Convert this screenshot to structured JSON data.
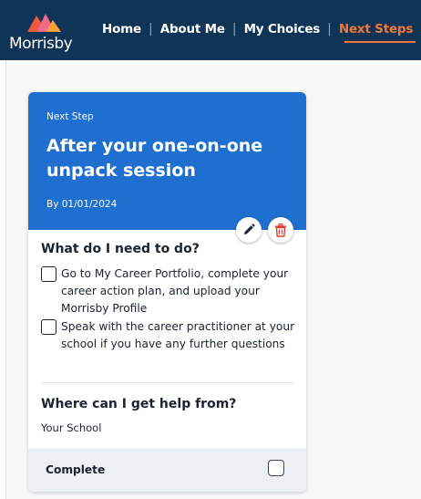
{
  "header": {
    "logo_text": "Morrisby",
    "logo_icon": "mountain-logo-icon",
    "nav": [
      {
        "label": "Home"
      },
      {
        "label": "About Me"
      },
      {
        "label": "My Choices"
      },
      {
        "label": "Next Steps",
        "active": true
      }
    ]
  },
  "card": {
    "eyebrow": "Next Step",
    "title": "After your one-on-one unpack session",
    "due": "By 01/01/2024",
    "edit_icon": "pencil-icon",
    "delete_icon": "trash-icon",
    "todo_heading": "What do I need to do?",
    "tasks": [
      {
        "text": "Go to My Career Portfolio, complete your career action plan, and upload your Morrisby Profile",
        "checked": false
      },
      {
        "text": "Speak with the career practitioner at your school if you have any further questions",
        "checked": false
      }
    ],
    "help_heading": "Where can I get help from?",
    "help_value": "Your School",
    "complete_label": "Complete",
    "complete_checked": false
  },
  "colors": {
    "header_bg": "#0f3455",
    "accent": "#f2793b",
    "card_head_bg": "#1e6fcf"
  }
}
